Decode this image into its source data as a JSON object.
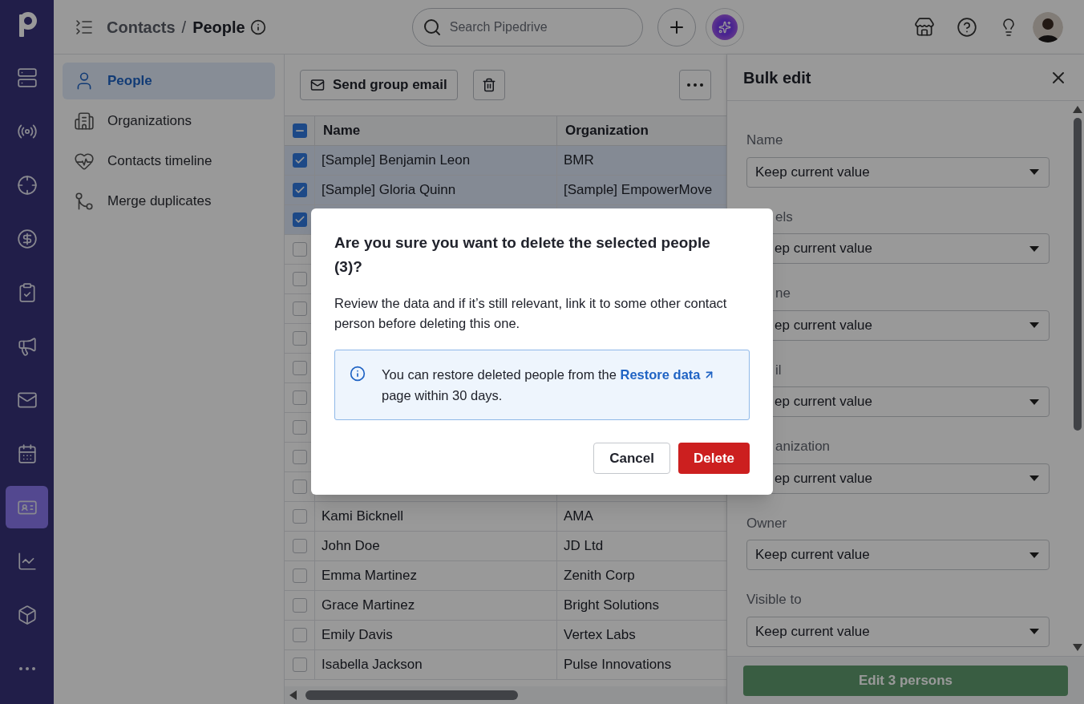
{
  "rail": {
    "items": [
      {
        "selected": false
      },
      {
        "selected": false
      },
      {
        "selected": false
      },
      {
        "selected": false
      },
      {
        "selected": false
      },
      {
        "selected": false
      },
      {
        "selected": false
      },
      {
        "selected": false
      },
      {
        "selected": true
      },
      {
        "selected": false
      },
      {
        "selected": false
      },
      {
        "selected": false
      }
    ]
  },
  "topbar": {
    "breadcrumb": [
      "Contacts",
      "People"
    ],
    "separator": "/",
    "search": {
      "placeholder": "Search Pipedrive"
    }
  },
  "subnav": {
    "items": [
      {
        "label": "People",
        "selected": true
      },
      {
        "label": "Organizations",
        "selected": false
      },
      {
        "label": "Contacts timeline",
        "selected": false
      },
      {
        "label": "Merge duplicates",
        "selected": false
      }
    ]
  },
  "toolbar": {
    "send_email": "Send group email"
  },
  "table": {
    "header_checkbox": {
      "partial": true
    },
    "columns": [
      "Name",
      "Organization"
    ],
    "rows": [
      {
        "checked": true,
        "name": "[Sample] Benjamin Leon",
        "organization": "BMR"
      },
      {
        "checked": true,
        "name": "[Sample] Gloria Quinn",
        "organization": "[Sample] EmpowerMove"
      },
      {
        "checked": true
      },
      {
        "checked": false
      },
      {
        "checked": false
      },
      {
        "checked": false
      },
      {
        "checked": false
      },
      {
        "checked": false
      },
      {
        "checked": false
      },
      {
        "checked": false
      },
      {
        "checked": false
      },
      {
        "checked": false
      },
      {
        "checked": false,
        "name": "Kami Bicknell",
        "organization": "AMA"
      },
      {
        "checked": false,
        "name": "John Doe",
        "organization": "JD Ltd"
      },
      {
        "checked": false,
        "name": "Emma Martinez",
        "organization": "Zenith Corp"
      },
      {
        "checked": false,
        "name": "Grace Martinez",
        "organization": "Bright Solutions"
      },
      {
        "checked": false,
        "name": "Emily Davis",
        "organization": "Vertex Labs"
      },
      {
        "checked": false,
        "name": "Isabella Jackson",
        "organization": "Pulse Innovations"
      }
    ]
  },
  "bulk_edit": {
    "title": "Bulk edit",
    "fields": [
      {
        "kind": "full",
        "label": "Name",
        "value": "Keep current value"
      },
      {
        "kind": "clipped",
        "label": "els",
        "value": "ep current value"
      },
      {
        "kind": "clipped",
        "label": "ne",
        "value": "ep current value"
      },
      {
        "kind": "clipped",
        "label": "il",
        "value": "ep current value"
      },
      {
        "kind": "clipped",
        "label": "anization",
        "value": "ep current value"
      },
      {
        "kind": "full",
        "label": "Owner",
        "value": "Keep current value"
      },
      {
        "kind": "full",
        "label": "Visible to",
        "value": "Keep current value"
      }
    ],
    "submit": {
      "label": "Edit 3 persons",
      "disabled": true
    }
  },
  "dialog": {
    "title": "Are you sure you want to delete the selected people (3)?",
    "body": "Review the data and if it’s still relevant, link it to some other contact person before deleting this one.",
    "notice": {
      "before": "You can restore deleted people from the",
      "link": "Restore data",
      "after": "page within 30 days."
    },
    "buttons": [
      {
        "kind": "secondary",
        "label": "Cancel"
      },
      {
        "kind": "danger",
        "label": "Delete"
      }
    ]
  }
}
